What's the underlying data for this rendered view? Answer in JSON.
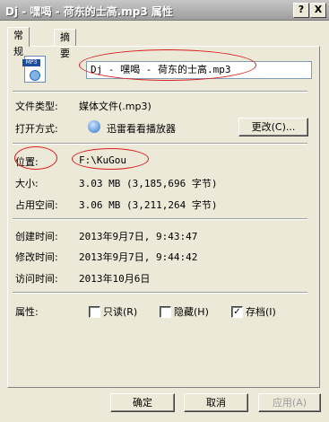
{
  "window": {
    "title": "Dj - 嘿喝 - 荷东的士高.mp3 属性",
    "help_btn": "?",
    "close_btn": "X"
  },
  "tabs": [
    {
      "label": "常规"
    },
    {
      "label": "摘要"
    }
  ],
  "file": {
    "icon_badge": "MP3",
    "name": "Dj - 嘿喝 - 荷东的士高.mp3"
  },
  "fields": {
    "type_label": "文件类型:",
    "type_value": "媒体文件(.mp3)",
    "open_label": "打开方式:",
    "open_value": "迅雷看看播放器",
    "change_btn": "更改(C)...",
    "location_label": "位置:",
    "location_value": "F:\\KuGou",
    "size_label": "大小:",
    "size_value": "3.03 MB (3,185,696 字节)",
    "disk_label": "占用空间:",
    "disk_value": "3.06 MB (3,211,264 字节)",
    "created_label": "创建时间:",
    "created_value": "2013年9月7日, 9:43:47",
    "modified_label": "修改时间:",
    "modified_value": "2013年9月7日, 9:44:42",
    "accessed_label": "访问时间:",
    "accessed_value": "2013年10月6日"
  },
  "attributes": {
    "label": "属性:",
    "readonly": {
      "label": "只读(R)",
      "checked": false
    },
    "hidden": {
      "label": "隐藏(H)",
      "checked": false
    },
    "archive": {
      "label": "存档(I)",
      "checked": true
    }
  },
  "buttons": {
    "ok": "确定",
    "cancel": "取消",
    "apply": "应用(A)"
  }
}
